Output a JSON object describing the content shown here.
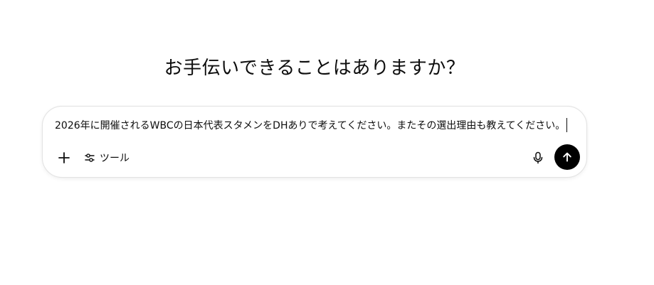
{
  "main": {
    "headline": "お手伝いできることはありますか？"
  },
  "composer": {
    "input_value": "2026年に開催されるWBCの日本代表スタメンをDHありで考えてください。またその選出理由も教えてください。",
    "tools_label": "ツール",
    "icons": {
      "attach": "plus-icon",
      "tools": "sliders-icon",
      "voice": "microphone-icon",
      "send": "arrow-up-icon"
    },
    "send_button_color": "#000000"
  }
}
